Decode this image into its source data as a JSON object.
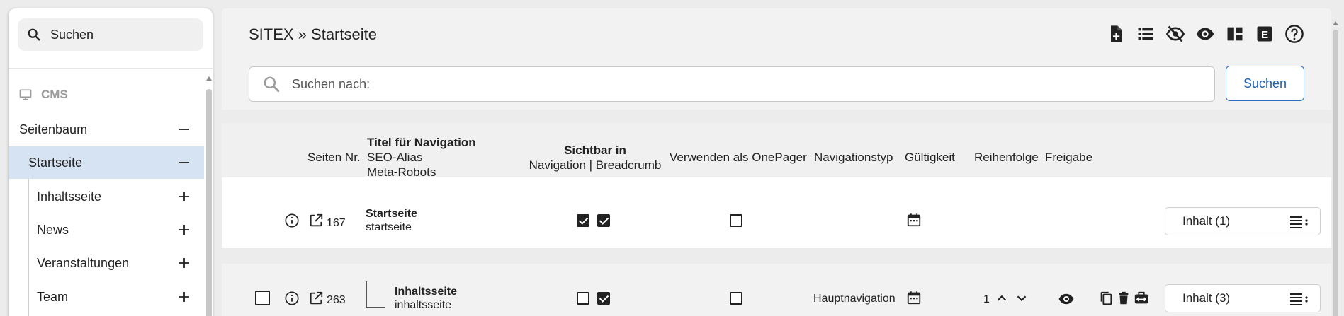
{
  "sidebar": {
    "search_label": "Suchen",
    "section_label": "CMS",
    "items": [
      {
        "label": "Seitenbaum",
        "control": "minus"
      },
      {
        "label": "Startseite",
        "control": "minus",
        "active": true
      },
      {
        "label": "Inhaltsseite",
        "control": "plus"
      },
      {
        "label": "News",
        "control": "plus"
      },
      {
        "label": "Veranstaltungen",
        "control": "plus"
      },
      {
        "label": "Team",
        "control": "plus"
      }
    ]
  },
  "header": {
    "breadcrumb": "SITEX » Startseite",
    "toolbar_icons": [
      "new-page-icon",
      "list-icon",
      "visibility-off-icon",
      "eye-icon",
      "dashboard-icon",
      "elementor-icon",
      "help-icon"
    ],
    "search_placeholder": "Suchen nach:",
    "search_button": "Suchen"
  },
  "table": {
    "columns": {
      "page_no": "Seiten Nr.",
      "title_line1": "Titel für Navigation",
      "title_line2": "SEO-Alias",
      "title_line3": "Meta-Robots",
      "visible_line1": "Sichtbar in",
      "visible_line2": "Navigation | Breadcrumb",
      "onepager": "Verwenden als OnePager",
      "nav_type": "Navigationstyp",
      "validity": "Gültigkeit",
      "order": "Reihenfolge",
      "release": "Freigabe"
    },
    "rows": [
      {
        "page_no": "167",
        "title": "Startseite",
        "alias": "startseite",
        "nav_visible": true,
        "breadcrumb_visible": true,
        "onepager": false,
        "nav_type": "",
        "order": "",
        "content_button": "Inhalt (1)"
      },
      {
        "page_no": "263",
        "title": "Inhaltsseite",
        "alias": "inhaltsseite",
        "nav_visible": false,
        "breadcrumb_visible": true,
        "onepager": false,
        "nav_type": "Hauptnavigation",
        "order": "1",
        "content_button": "Inhalt (3)"
      }
    ]
  },
  "colors": {
    "accent": "#1a5fb4",
    "active_tree_bg": "#d6e3f2",
    "header_bg": "#f2f2f2"
  }
}
